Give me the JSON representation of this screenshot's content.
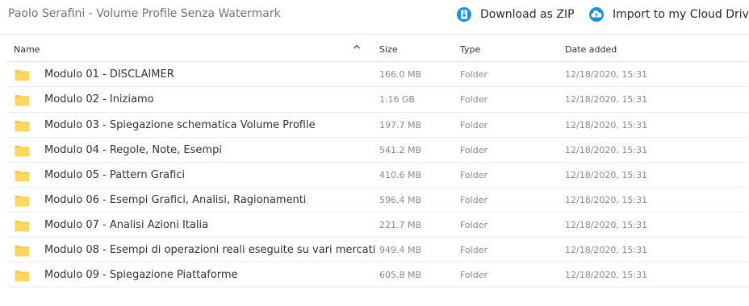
{
  "header": {
    "title": "Paolo Serafini - Volume Profile Senza Watermark",
    "download_label": "Download as ZIP",
    "cloud_label": "Import to my Cloud Drive"
  },
  "columns": {
    "name": "Name",
    "size": "Size",
    "type": "Type",
    "date": "Date added"
  },
  "colors": {
    "accent": "#1f8fd6",
    "folder": "#f6c94a"
  },
  "rows": [
    {
      "name": "Modulo 01 - DISCLAIMER",
      "size": "166.0 MB",
      "type": "Folder",
      "date": "12/18/2020, 15:31"
    },
    {
      "name": "Modulo 02 - Iniziamo",
      "size": "1.16 GB",
      "type": "Folder",
      "date": "12/18/2020, 15:31"
    },
    {
      "name": "Modulo 03 - Spiegazione schematica Volume Profile",
      "size": "197.7 MB",
      "type": "Folder",
      "date": "12/18/2020, 15:31"
    },
    {
      "name": "Modulo 04 - Regole, Note, Esempi",
      "size": "541.2 MB",
      "type": "Folder",
      "date": "12/18/2020, 15:31"
    },
    {
      "name": "Modulo 05 - Pattern Grafici",
      "size": "410.6 MB",
      "type": "Folder",
      "date": "12/18/2020, 15:31"
    },
    {
      "name": "Modulo 06 - Esempi Grafici, Analisi, Ragionamenti",
      "size": "596.4 MB",
      "type": "Folder",
      "date": "12/18/2020, 15:31"
    },
    {
      "name": "Modulo 07 - Analisi Azioni Italia",
      "size": "221.7 MB",
      "type": "Folder",
      "date": "12/18/2020, 15:31"
    },
    {
      "name": "Modulo 08 - Esempi di operazioni reali eseguite su vari mercati",
      "size": "949.4 MB",
      "type": "Folder",
      "date": "12/18/2020, 15:31"
    },
    {
      "name": "Modulo 09 - Spiegazione Piattaforme",
      "size": "605.8 MB",
      "type": "Folder",
      "date": "12/18/2020, 15:31"
    }
  ]
}
